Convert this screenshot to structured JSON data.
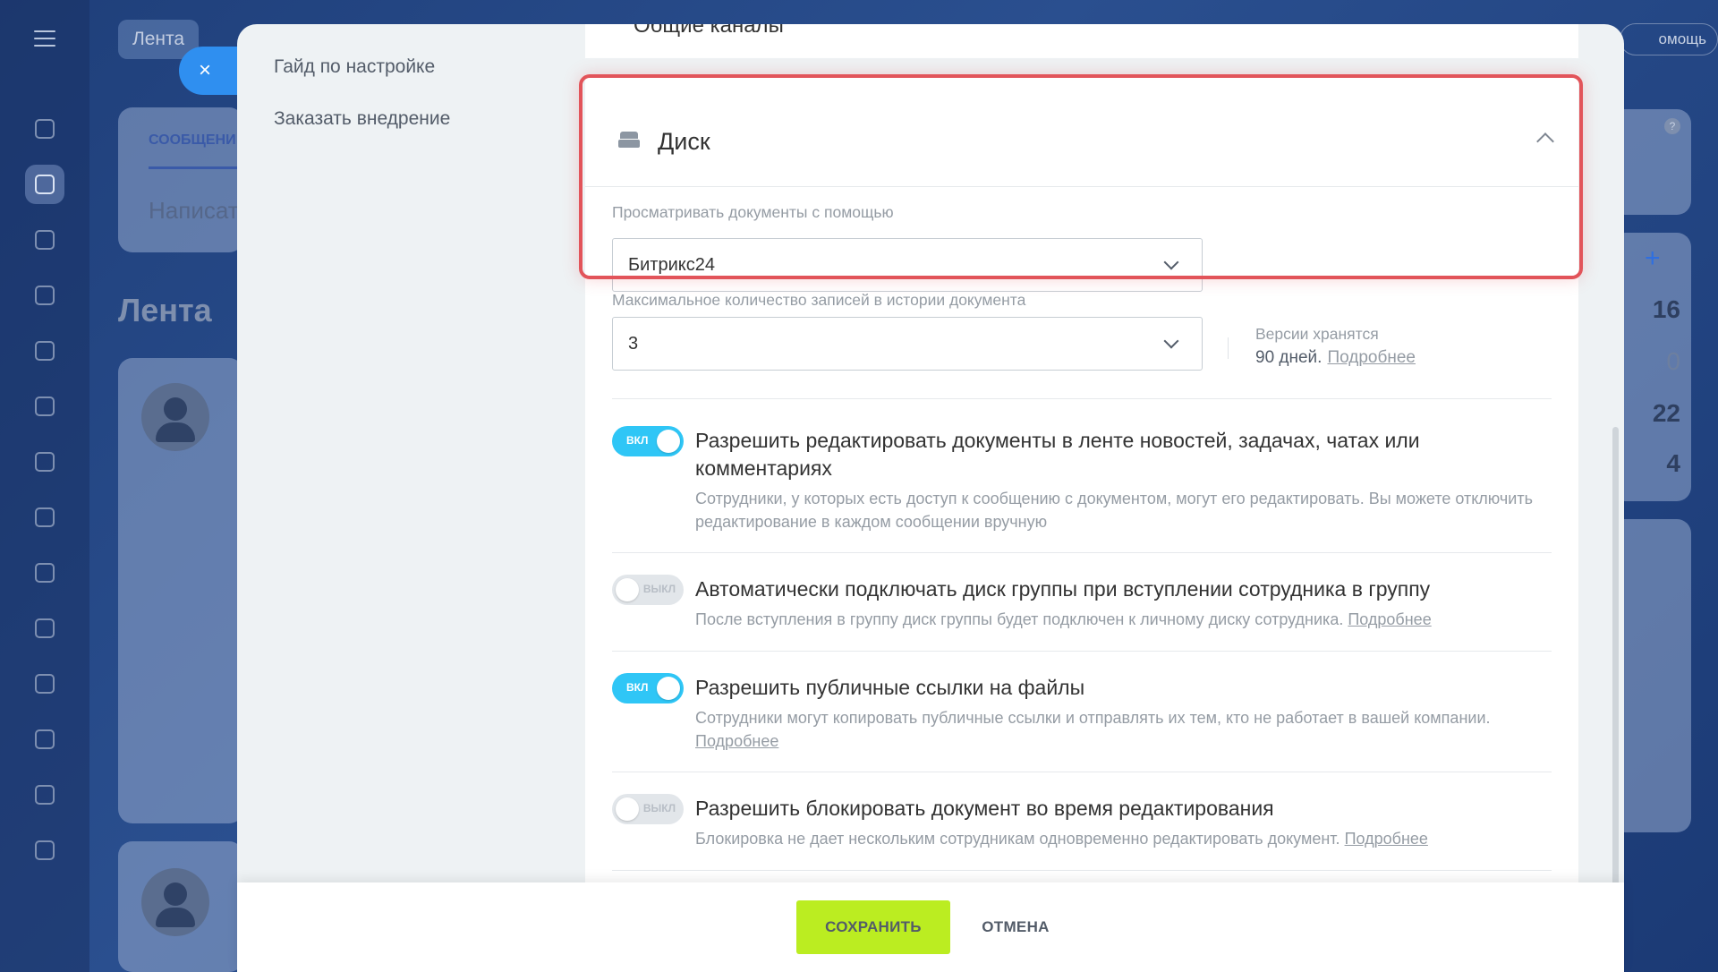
{
  "background": {
    "tab_label": "Лента",
    "composer_tab": "СООБЩЕНИ",
    "composer_placeholder": "Написат",
    "feed_title": "Лента",
    "help_label": "омощь",
    "counters": [
      "16",
      "0",
      "22",
      "4"
    ],
    "plus": "+",
    "qmark": "?"
  },
  "close_button": {
    "icon": "×"
  },
  "left_menu": {
    "items": [
      {
        "label": "Гайд по настройке"
      },
      {
        "label": "Заказать внедрение"
      }
    ]
  },
  "previous_section": {
    "title": "Общие каналы"
  },
  "disk_section": {
    "title": "Диск",
    "viewer": {
      "label": "Просматривать документы с помощью",
      "value": "Битрикс24"
    },
    "history": {
      "label": "Максимальное количество записей в истории документа",
      "value": "3",
      "versions_label": "Версии хранятся",
      "versions_text": "90 дней.",
      "versions_link": "Подробнее"
    },
    "options": [
      {
        "state_label": "ВКЛ",
        "enabled": true,
        "title": "Разрешить редактировать документы в ленте новостей, задачах, чатах или комментариях",
        "desc": "Сотрудники, у которых есть доступ к сообщению с документом, могут его редактировать. Вы можете отключить редактирование в каждом сообщении вручную",
        "link": ""
      },
      {
        "state_label": "ВЫКЛ",
        "enabled": false,
        "title": "Автоматически подключать диск группы при вступлении сотрудника в группу",
        "desc": "После вступления в группу диск группы будет подключен к личному диску сотрудника.",
        "link": "Подробнее"
      },
      {
        "state_label": "ВКЛ",
        "enabled": true,
        "title": "Разрешить публичные ссылки на файлы",
        "desc": "Сотрудники могут копировать публичные ссылки и отправлять их тем, кто не работает в вашей компании.",
        "link": "Подробнее"
      },
      {
        "state_label": "ВЫКЛ",
        "enabled": false,
        "title": "Разрешить блокировать документ во время редактирования",
        "desc": "Блокировка не дает нескольким сотрудникам одновременно редактировать документ.",
        "link": "Подробнее"
      }
    ]
  },
  "footer": {
    "save_label": "СОХРАНИТЬ",
    "cancel_label": "ОТМЕНА"
  },
  "colors": {
    "accent_save": "#bbed21",
    "toggle_on": "#2fc6f6",
    "highlight": "#e2545a",
    "close_button": "#2f8ff0"
  }
}
